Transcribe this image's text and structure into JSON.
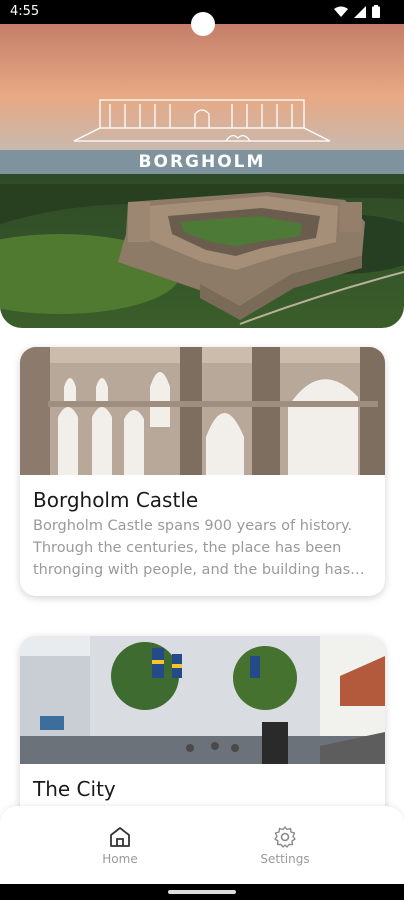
{
  "status_bar": {
    "time": "4:55"
  },
  "hero": {
    "logo_text": "BORGHOLM"
  },
  "cards": [
    {
      "title": "Borgholm Castle",
      "description": "Borgholm Castle spans 900 years of history. Through the centuries, the place has been thronging with people, and the building has…"
    },
    {
      "title": "The City",
      "description": ""
    }
  ],
  "nav": {
    "items": [
      {
        "label": "Home",
        "icon": "home-icon"
      },
      {
        "label": "Settings",
        "icon": "gear-icon"
      }
    ]
  }
}
